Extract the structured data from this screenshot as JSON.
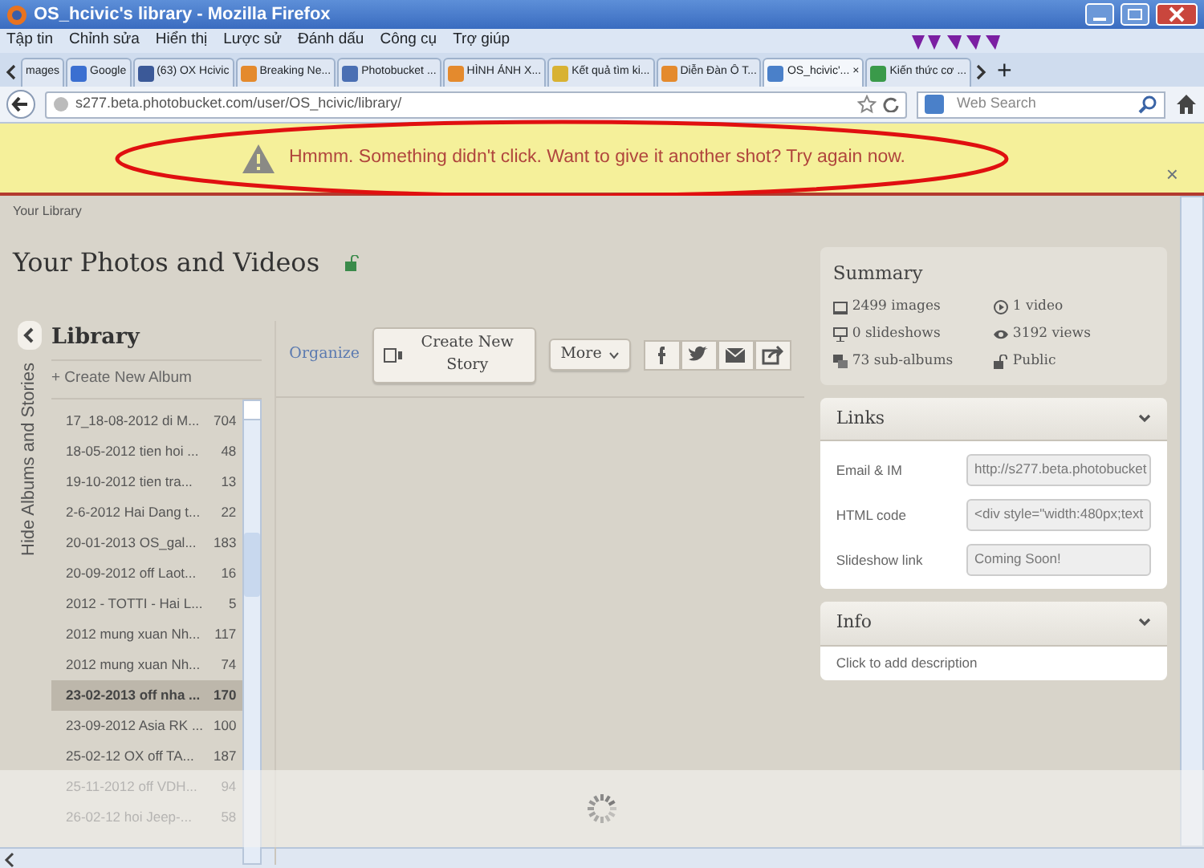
{
  "window": {
    "title": "OS_hcivic's library - Mozilla Firefox"
  },
  "menu": [
    "Tập tin",
    "Chỉnh sửa",
    "Hiển thị",
    "Lược sử",
    "Đánh dấu",
    "Công cụ",
    "Trợ giúp"
  ],
  "tabs": [
    {
      "label": "mages",
      "selected": false
    },
    {
      "label": "Google",
      "selected": false
    },
    {
      "label": "(63) OX Hcivic",
      "selected": false
    },
    {
      "label": "Breaking Ne...",
      "selected": false
    },
    {
      "label": "Photobucket ...",
      "selected": false
    },
    {
      "label": "HÌNH ẢNH X...",
      "selected": false
    },
    {
      "label": "Kết quả tìm ki...",
      "selected": false
    },
    {
      "label": "Diễn Đàn Ô T...",
      "selected": false
    },
    {
      "label": "OS_hcivic'...",
      "selected": true
    },
    {
      "label": "Kiến thức cơ ...",
      "selected": false
    }
  ],
  "tab_close": "×",
  "tab_new": "+",
  "address_bar": {
    "url": "s277.beta.photobucket.com/user/OS_hcivic/library/"
  },
  "search": {
    "placeholder": "Web Search"
  },
  "banner": {
    "message": "Hmmm. Something didn't click. Want to give it another shot? Try again now.",
    "close": "×"
  },
  "breadcrumb": "Your Library",
  "page_title": "Your Photos and Videos",
  "library": {
    "title": "Library",
    "toggle": "Hide Albums and Stories",
    "create": "+ Create New Album",
    "albums": [
      {
        "name": "17_18-08-2012 di M...",
        "count": "704",
        "selected": false
      },
      {
        "name": "18-05-2012 tien hoi ...",
        "count": "48",
        "selected": false
      },
      {
        "name": "19-10-2012 tien tra...",
        "count": "13",
        "selected": false
      },
      {
        "name": "2-6-2012 Hai Dang t...",
        "count": "22",
        "selected": false
      },
      {
        "name": "20-01-2013 OS_gal...",
        "count": "183",
        "selected": false
      },
      {
        "name": "20-09-2012 off Laot...",
        "count": "16",
        "selected": false
      },
      {
        "name": "2012 - TOTTI - Hai L...",
        "count": "5",
        "selected": false
      },
      {
        "name": "2012 mung xuan Nh...",
        "count": "117",
        "selected": false
      },
      {
        "name": "2012 mung xuan Nh...",
        "count": "74",
        "selected": false
      },
      {
        "name": "23-02-2013 off nha ...",
        "count": "170",
        "selected": true
      },
      {
        "name": "23-09-2012 Asia RK ...",
        "count": "100",
        "selected": false
      },
      {
        "name": "25-02-12 OX off TA...",
        "count": "187",
        "selected": false
      },
      {
        "name": "25-11-2012 off VDH...",
        "count": "94",
        "selected": false
      },
      {
        "name": "26-02-12 hoi Jeep-...",
        "count": "58",
        "selected": false
      }
    ]
  },
  "toolbar": {
    "organize": "Organize",
    "create_story": "Create New Story",
    "more": "More"
  },
  "summary": {
    "title": "Summary",
    "stats": [
      {
        "kind": "images",
        "text": "2499 images"
      },
      {
        "kind": "video",
        "text": "1 video"
      },
      {
        "kind": "slideshows",
        "text": "0 slideshows"
      },
      {
        "kind": "views",
        "text": "3192 views"
      },
      {
        "kind": "subalbums",
        "text": "73 sub-albums"
      },
      {
        "kind": "public",
        "text": "Public"
      }
    ]
  },
  "links": {
    "title": "Links",
    "fields": [
      {
        "label": "Email & IM",
        "value": "http://s277.beta.photobucket"
      },
      {
        "label": "HTML code",
        "value": "<div style=\"width:480px;text"
      },
      {
        "label": "Slideshow link",
        "value": "Coming Soon!"
      }
    ]
  },
  "info": {
    "title": "Info",
    "text": "Click to add description"
  }
}
